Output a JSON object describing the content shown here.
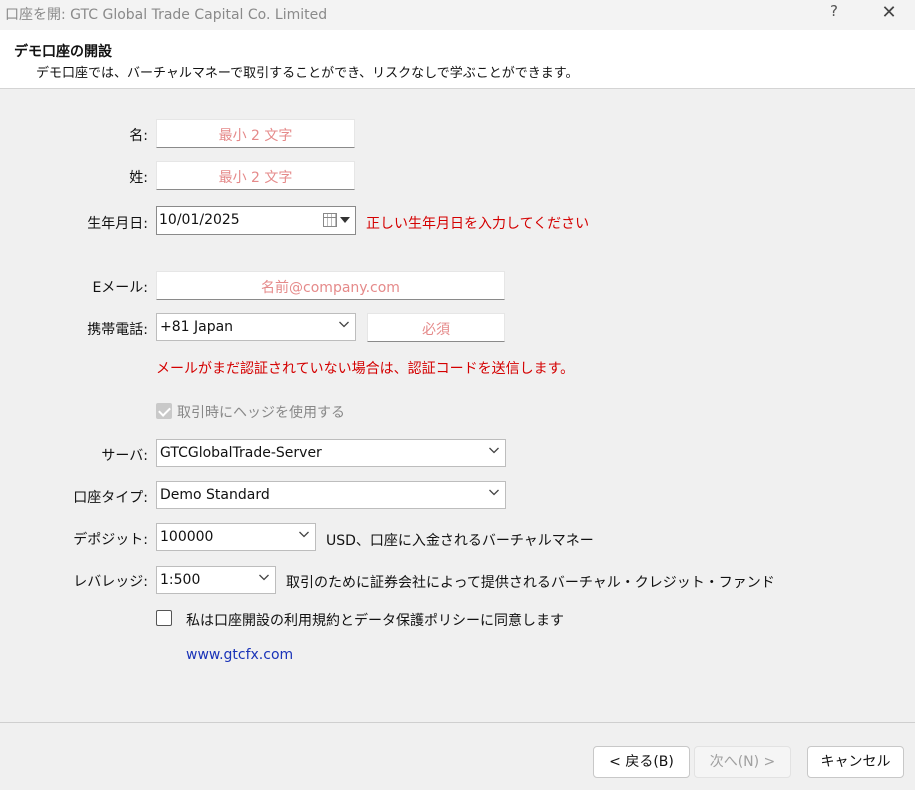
{
  "window": {
    "title": "口座を開: GTC Global Trade Capital Co. Limited",
    "help_label": "?",
    "close_label": "✕"
  },
  "header": {
    "title": "デモ口座の開設",
    "subtitle": "デモ口座では、バーチャルマネーで取引することができ、リスクなしで学ぶことができます。"
  },
  "form": {
    "first_name": {
      "label": "名:",
      "placeholder": "最小 2 文字"
    },
    "last_name": {
      "label": "姓:",
      "placeholder": "最小 2 文字"
    },
    "birthdate": {
      "label": "生年月日:",
      "value": "10/01/2025",
      "error": "正しい生年月日を入力してください"
    },
    "email": {
      "label": "Eメール:",
      "placeholder": "名前@company.com"
    },
    "phone": {
      "label": "携帯電話:",
      "country": "+81 Japan",
      "placeholder": "必須"
    },
    "verify_notice": "メールがまだ認証されていない場合は、認証コードを送信します。",
    "hedge": {
      "label": "取引時にヘッジを使用する",
      "checked": true,
      "disabled": true
    },
    "server": {
      "label": "サーバ:",
      "value": "GTCGlobalTrade-Server"
    },
    "account_type": {
      "label": "口座タイプ:",
      "value": "Demo Standard"
    },
    "deposit": {
      "label": "デポジット:",
      "value": "100000",
      "note": "USD、口座に入金されるバーチャルマネー"
    },
    "leverage": {
      "label": "レバレッジ:",
      "value": "1:500",
      "note": "取引のために証券会社によって提供されるバーチャル・クレジット・ファンド"
    },
    "agree": {
      "label": "私は口座開設の利用規約とデータ保護ポリシーに同意します",
      "checked": false
    },
    "website": "www.gtcfx.com"
  },
  "buttons": {
    "back": "< 戻る(B)",
    "next": "次へ(N) >",
    "cancel": "キャンセル"
  },
  "colors": {
    "error": "#d40000",
    "placeholder": "#e58a8a",
    "link": "#1a33b8"
  }
}
